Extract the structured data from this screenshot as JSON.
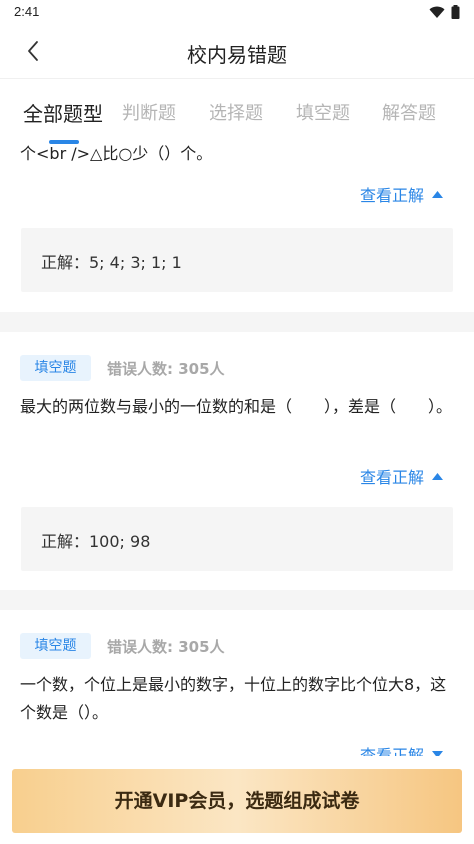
{
  "status_bar": {
    "time": "2:41"
  },
  "header": {
    "title": "校内易错题"
  },
  "tabs": [
    {
      "label": "全部题型",
      "active": true
    },
    {
      "label": "判断题",
      "active": false
    },
    {
      "label": "选择题",
      "active": false
    },
    {
      "label": "填空题",
      "active": false
    },
    {
      "label": "解答题",
      "active": false
    }
  ],
  "questions": [
    {
      "text": "个<br />△比○少（）个。",
      "toggle_label": "查看正解",
      "expanded": true,
      "answer": "正解：5; 4; 3; 1; 1"
    },
    {
      "type_tag": "填空题",
      "error_count": "错误人数: 305人",
      "text": "最大的两位数与最小的一位数的和是（　　），差是（　　）。",
      "toggle_label": "查看正解",
      "expanded": true,
      "answer": "正解：100; 98"
    },
    {
      "type_tag": "填空题",
      "error_count": "错误人数: 305人",
      "text": "一个数，个位上是最小的数字，十位上的数字比个位大8，这个数是（）。",
      "toggle_label": "查看正解",
      "expanded": false
    }
  ],
  "vip_button": {
    "label": "开通VIP会员，选题组成试卷"
  },
  "colors": {
    "accent": "#2a86e6",
    "tag_bg": "#e8f3fd",
    "vip_gradient_start": "#f8cf8e",
    "vip_gradient_end": "#f6c681"
  },
  "icons": {
    "back": "chevron-left-icon",
    "wifi": "wifi-icon",
    "battery": "battery-icon",
    "collapse": "caret-up-icon",
    "expand": "caret-down-icon"
  }
}
